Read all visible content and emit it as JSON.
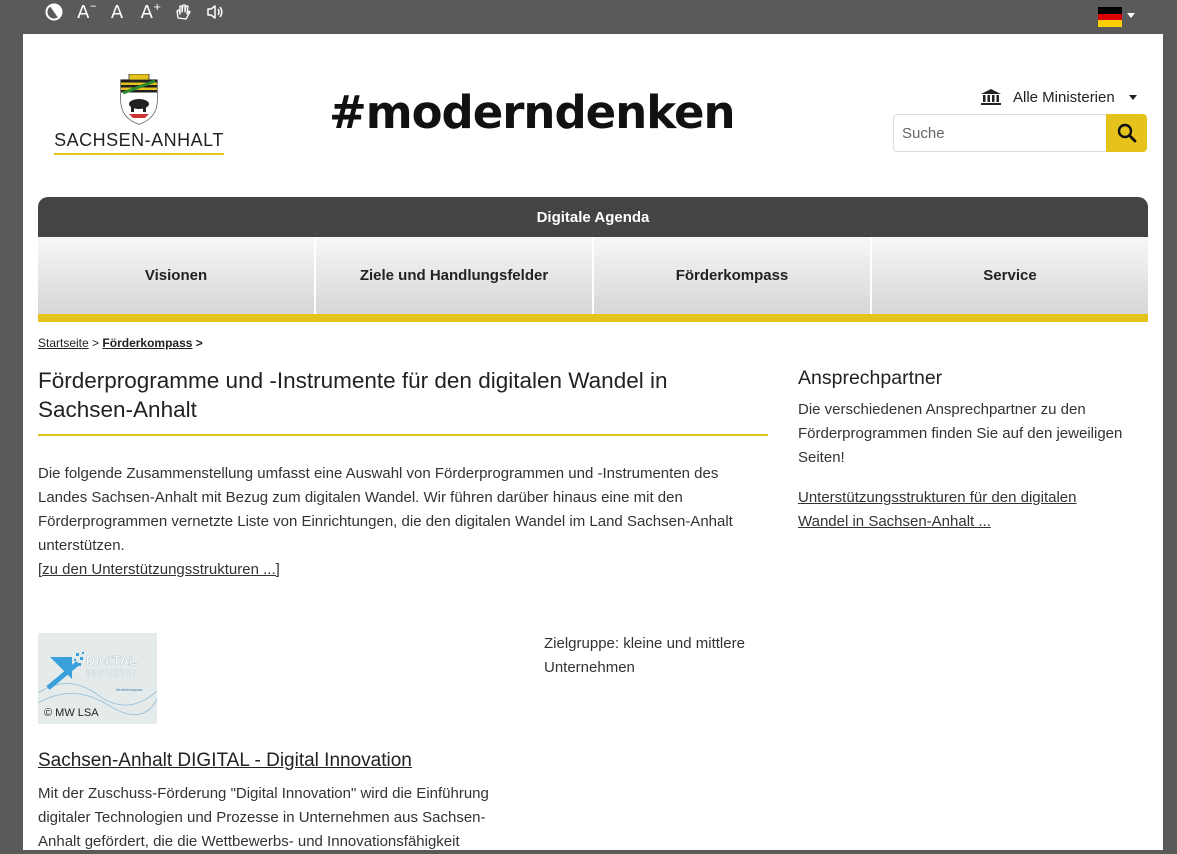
{
  "accessibility_toolbar": {
    "items": [
      "contrast-icon",
      "font-smaller-icon",
      "font-normal-icon",
      "font-larger-icon",
      "sign-language-icon",
      "read-aloud-icon"
    ],
    "font_smaller": "A",
    "font_normal": "A",
    "font_larger": "A",
    "language": "Deutsch"
  },
  "header": {
    "logo_text": "SACHSEN-ANHALT",
    "hashtag": "#moderndenken",
    "ministry_label": "Alle Ministerien",
    "search_placeholder": "Suche"
  },
  "nav": {
    "top_label": "Digitale Agenda",
    "items": [
      "Visionen",
      "Ziele und Handlungsfelder",
      "Förderkompass",
      "Service"
    ]
  },
  "breadcrumb": {
    "home": "Startseite",
    "sep1": ">",
    "current": "Förderkompass",
    "sep2": ">"
  },
  "main": {
    "title": "Förderprogramme und -Instrumente für den digitalen Wandel in Sachsen-Anhalt",
    "intro": "Die folgende Zusammenstellung umfasst eine Auswahl von Förderprogrammen und -Instrumenten des Landes Sachsen-Anhalt mit Bezug zum digitalen Wandel. Wir führen darüber hinaus eine mit den Förderprogrammen vernetzte Liste von Einrichtungen, die den digitalen Wandel im Land Sachsen-Anhalt unterstützen.",
    "intro_link": "[zu den Unterstützungsstrukturen ...]",
    "article": {
      "thumb_title": "DIGITAL",
      "thumb_subtitle": "INNOVATION",
      "thumb_small": "förderkompass",
      "thumb_copyright": "©  MW LSA",
      "zielgruppe": "Zielgruppe: kleine und mittlere Unternehmen",
      "title": "Sachsen-Anhalt DIGITAL - Digital Innovation",
      "text": "Mit der Zuschuss-Förderung \"Digital Innovation\" wird die Einführung digitaler Technologien und Prozesse in Unternehmen aus Sachsen-Anhalt gefördert, die die Wettbewerbs- und Innovationsfähigkeit"
    }
  },
  "sidebar": {
    "title": "Ansprechpartner",
    "text": "Die verschiedenen Ansprechpartner zu den Förderprogrammen finden Sie auf den jeweiligen Seiten!",
    "link": "Unterstützungsstrukturen für den digitalen Wandel in Sachsen-Anhalt ..."
  },
  "colors": {
    "accent_yellow": "#e6c31c",
    "nav_dark": "#444444",
    "page_bg": "#5a5a5a"
  }
}
